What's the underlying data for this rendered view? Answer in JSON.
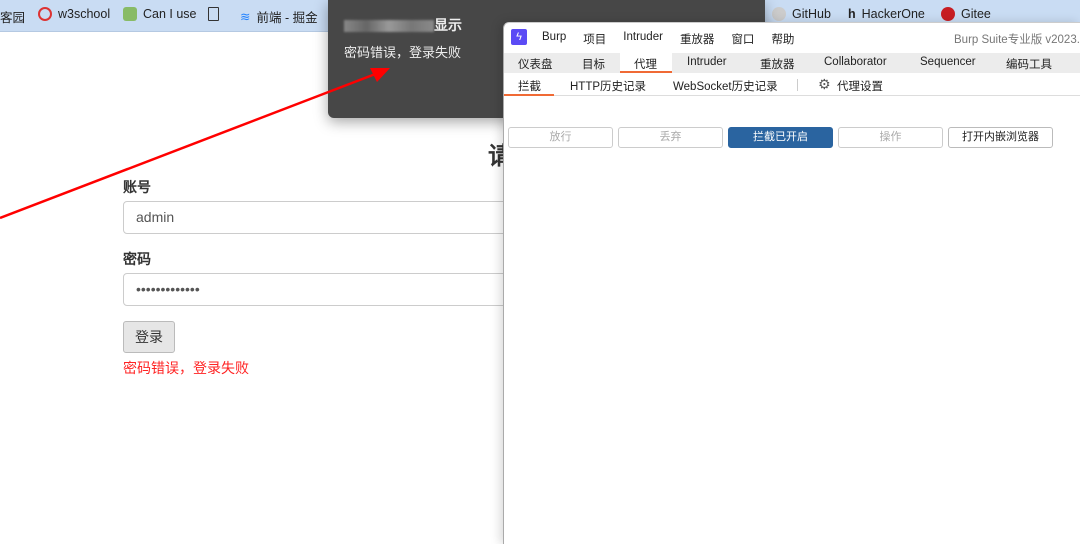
{
  "bookmarks": [
    {
      "label": "客园",
      "icon": "cnblogs-icon"
    },
    {
      "label": "w3school",
      "icon": "w3school-icon"
    },
    {
      "label": "Can I use",
      "icon": "caniuse-icon"
    },
    {
      "label": "",
      "icon": "document-icon"
    },
    {
      "label": "前端 - 掘金",
      "icon": "juejin-icon"
    },
    {
      "label": "GitHub",
      "icon": "github-icon"
    },
    {
      "label": "HackerOne",
      "icon": "hackerone-icon"
    },
    {
      "label": "Gitee",
      "icon": "gitee-icon"
    }
  ],
  "page": {
    "heading": "请",
    "username_label": "账号",
    "username_value": "admin",
    "password_label": "密码",
    "password_value": "•••••••••••••",
    "login_button": "登录",
    "error": "密码错误，登录失败"
  },
  "dialog": {
    "title_suffix": "显示",
    "message": "密码错误，登录失败"
  },
  "burp": {
    "menu": [
      "Burp",
      "项目",
      "Intruder",
      "重放器",
      "窗口",
      "帮助"
    ],
    "title": "Burp Suite专业版  v2023.",
    "tabs": [
      "仪表盘",
      "目标",
      "代理",
      "Intruder",
      "重放器",
      "Collaborator",
      "Sequencer",
      "编码工具"
    ],
    "active_tab": "代理",
    "subtabs": [
      "拦截",
      "HTTP历史记录",
      "WebSocket历史记录"
    ],
    "proxy_settings": "代理设置",
    "buttons": {
      "forward": "放行",
      "drop": "丢弃",
      "intercept": "拦截已开启",
      "action": "操作",
      "open_browser": "打开内嵌浏览器"
    },
    "accent": "#2a64a0"
  },
  "annotation_color": "#ff0000"
}
